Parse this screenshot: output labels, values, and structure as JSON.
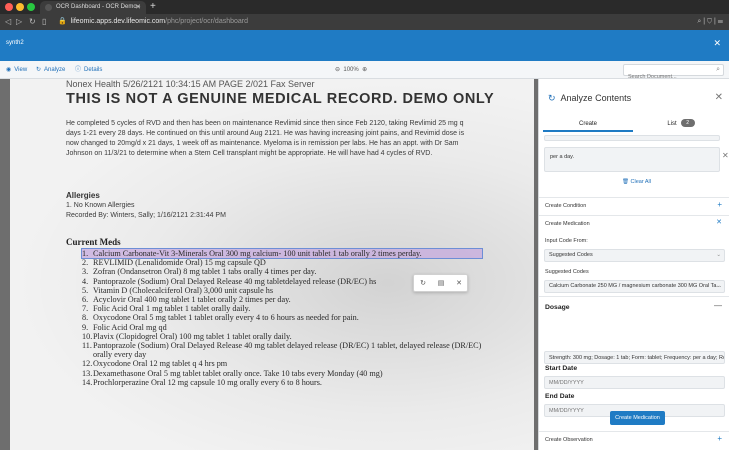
{
  "browser": {
    "tab_title": "OCR Dashboard - OCR Demo -",
    "new_tab": "+",
    "url_domain": "lifeomic.apps.dev.lifeomic.com",
    "url_path": "/phc/project/ocr/dashboard"
  },
  "app": {
    "title": "synth2"
  },
  "toolbar": {
    "view_label": "View",
    "analyze_label": "Analyze",
    "details_label": "Details",
    "zoom_level": "100%",
    "search_placeholder": "Search Document..."
  },
  "document": {
    "fax_header": "Nonex Health 5/26/2121 10:34:15 AM PAGE 2/021 Fax Server",
    "title": "THIS IS NOT A GENUINE MEDICAL RECORD. DEMO ONLY",
    "paragraph": "He completed 5 cycles of RVD and then has been on maintenance Revlimid since then since Feb 2120, taking Revlimid 25 mg q days 1-21 every 28 days. He continued on this until around Aug 2121. He was having increasing joint pains, and Revimid dose is now changed to 20mg/d x 21 days, 1 week off as maintenance. Myeloma is in remission per labs. He has an appt. with Dr Sam Johnson on 11/3/21 to determine when a Stem Cell transplant might be appropriate. He will have had 4 cycles of RVD.",
    "allergies_heading": "Allergies",
    "allergies_item": "1. No Known Allergies",
    "recorded_by": "Recorded By: Winters, Sally; 1/16/2121 2:31:44 PM",
    "meds_heading": "Current Meds",
    "meds": [
      {
        "num": "1.",
        "text": "Calcium Carbonate-Vit 3-Minerals Oral 300 mg calcium- 100 unit tablet 1 tab orally 2 times perday."
      },
      {
        "num": "2.",
        "text": "REVLIMID (Lenalidomide Oral) 15 mg capsule QD"
      },
      {
        "num": "3.",
        "text": "Zofran (Ondansetron Oral) 8 mg tablet 1 tabs orally 4 times per day."
      },
      {
        "num": "4.",
        "text": "Pantoprazole (Sodium) Oral Delayed Release 40 mg tabletdelayed release (DR/EC) hs"
      },
      {
        "num": "5.",
        "text": "Vitamin D (Cholecalciferol Oral) 3,000 unit capsule hs"
      },
      {
        "num": "6.",
        "text": "Acyclovir Oral 400 mg tablet 1 tablet orally 2 times per day."
      },
      {
        "num": "7.",
        "text": "Folic Acid Oral 1 mg tablet 1 tablet orally daily."
      },
      {
        "num": "8.",
        "text": "Oxycodone Oral 5 mg tablet 1 tablet orally every 4 to 6 hours as needed for pain."
      },
      {
        "num": "9.",
        "text": "Folic Acid Oral mg qd"
      },
      {
        "num": "10.",
        "text": "Plavix (Clopidogrel Oral) 100 mg tablet 1 tablet orally daily."
      },
      {
        "num": "11.",
        "text": "Pantoprazole (Sodium) Oral Delayed Release 40 mg tablet delayed release (DR/EC) 1 tablet, delayed release (DR/EC) orally every day"
      },
      {
        "num": "12.",
        "text": "Oxycodone Oral 12 mg tablet q 4 hrs pm"
      },
      {
        "num": "13.",
        "text": "Dexamethasone Oral 5 mg tablet tablet orally once. Take 10 tabs every Monday (40 mg)"
      },
      {
        "num": "14.",
        "text": "Prochlorperazine Oral 12 mg capsule 10 mg orally every 6 to 8 hours."
      }
    ]
  },
  "panel": {
    "title": "Analyze Contents",
    "tab_create": "Create",
    "tab_list": "List",
    "list_count": "2",
    "note_text": "per a day.",
    "clear_all": "Clear All",
    "create_condition": "Create Condition",
    "create_medication": "Create Medication",
    "input_code_from_label": "Input Code From:",
    "input_code_from_value": "Suggested Codes",
    "suggested_codes_label": "Suggested Codes",
    "suggested_codes_value": "Calcium Carbonate 250 MG / magnesium carbonate 300 MG Oral Ta...",
    "dosage_label": "Dosage",
    "dosage_value": "Strength: 300 mg; Dosage: 1 tab; Form: tablet; Frequency: per a day; Rout",
    "start_date_label": "Start Date",
    "start_date_placeholder": "MM/DD/YYYY",
    "end_date_label": "End Date",
    "end_date_placeholder": "MM/DD/YYYY",
    "create_medication_button": "Create Medication",
    "create_observation": "Create Observation"
  },
  "colors": {
    "accent": "#1f7bc4",
    "highlight": "#c6aade"
  }
}
